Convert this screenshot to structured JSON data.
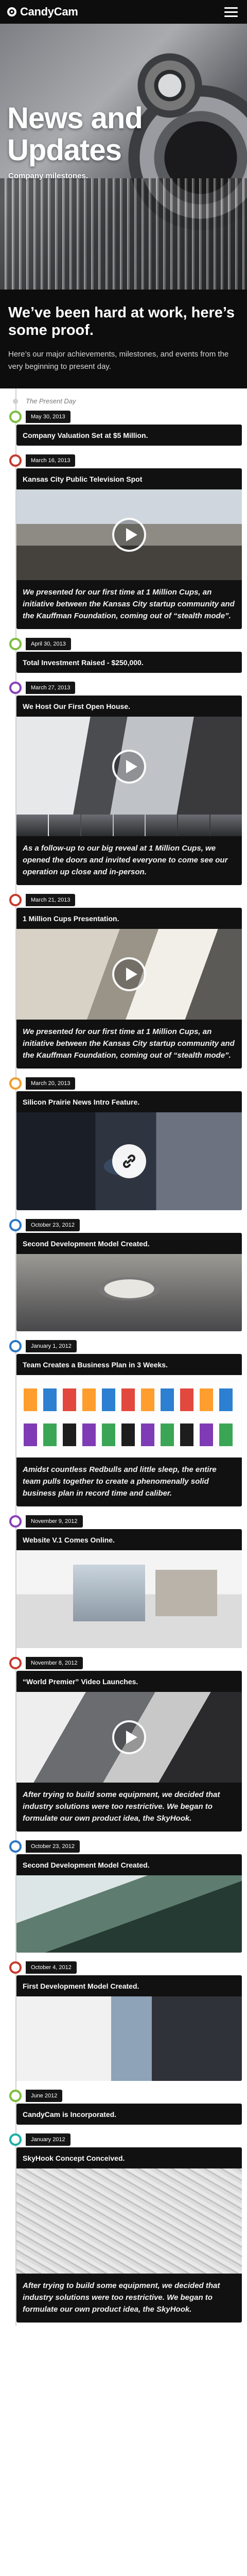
{
  "header": {
    "brand": "CandyCam",
    "menu_icon": "hamburger-menu-icon"
  },
  "hero": {
    "title": "News and Updates",
    "subtitle": "Company milestones."
  },
  "intro": {
    "heading": "We’ve been hard at work, here’s some proof.",
    "text": "Here’s our major achievements, milestones, and events from the very beginning to present day."
  },
  "timeline": {
    "start_label": "The Present Day",
    "entries": [
      {
        "date": "May 30, 2013",
        "title": "Company Valuation Set at $5 Million.",
        "color": "#7cbd3f",
        "media": "none",
        "body": ""
      },
      {
        "date": "March 16, 2013",
        "title": "Kansas City Public Television Spot",
        "color": "#c83a2d",
        "media": "video",
        "body": "We presented for our first time at 1 Million Cups, an initiative between the Kansas City startup community and the Kauffman Foundation, coming out of “stealth mode”."
      },
      {
        "date": "April 30, 2013",
        "title": "Total Investment Raised - $250,000.",
        "color": "#7cbd3f",
        "media": "none",
        "body": ""
      },
      {
        "date": "March 27, 2013",
        "title": "We Host Our First Open House.",
        "color": "#8a3fb6",
        "media": "gallery",
        "body": "As a follow-up to our big reveal at 1 Million Cups, we opened the doors and invited everyone to come see our operation up close and in-person."
      },
      {
        "date": "March 21, 2013",
        "title": "1 Million Cups Presentation.",
        "color": "#c83a2d",
        "media": "video",
        "body": "We presented for our first time at 1 Million Cups, an initiative between the Kansas City startup community and the Kauffman Foundation, coming out of “stealth mode”."
      },
      {
        "date": "March 20, 2013",
        "title": "Silicon Prairie News Intro Feature.",
        "color": "#f09e2c",
        "media": "link",
        "body": ""
      },
      {
        "date": "October 23, 2012",
        "title": "Second Development Model Created.",
        "color": "#2c77c4",
        "media": "image",
        "body": ""
      },
      {
        "date": "January 1, 2012",
        "title": "Team Creates a Business Plan in 3 Weeks.",
        "color": "#2c77c4",
        "media": "image",
        "body": "Amidst countless Redbulls and little sleep, the entire team pulls together to create a phenomenally solid business plan in record time and caliber."
      },
      {
        "date": "November 9, 2012",
        "title": "Website V.1 Comes Online.",
        "color": "#8a3fb6",
        "media": "image",
        "body": ""
      },
      {
        "date": "November 8, 2012",
        "title": "“World Premier” Video Launches.",
        "color": "#c83a2d",
        "media": "video",
        "body": "After trying to build some equipment, we decided that industry solutions were too restrictive. We began to formulate our own product idea, the SkyHook."
      },
      {
        "date": "October 23, 2012",
        "title": "Second Development Model Created.",
        "color": "#2c77c4",
        "media": "image",
        "body": ""
      },
      {
        "date": "October 4, 2012",
        "title": "First Development Model Created.",
        "color": "#c83a2d",
        "media": "image",
        "body": ""
      },
      {
        "date": "June 2012",
        "title": "CandyCam is Incorporated.",
        "color": "#7cbd3f",
        "media": "none",
        "body": ""
      },
      {
        "date": "January 2012",
        "title": "SkyHook Concept Conceived.",
        "color": "#1bb0a6",
        "media": "image",
        "body": "After trying to build some equipment, we decided that industry solutions were too restrictive. We began to formulate our own product idea, the SkyHook."
      }
    ]
  }
}
